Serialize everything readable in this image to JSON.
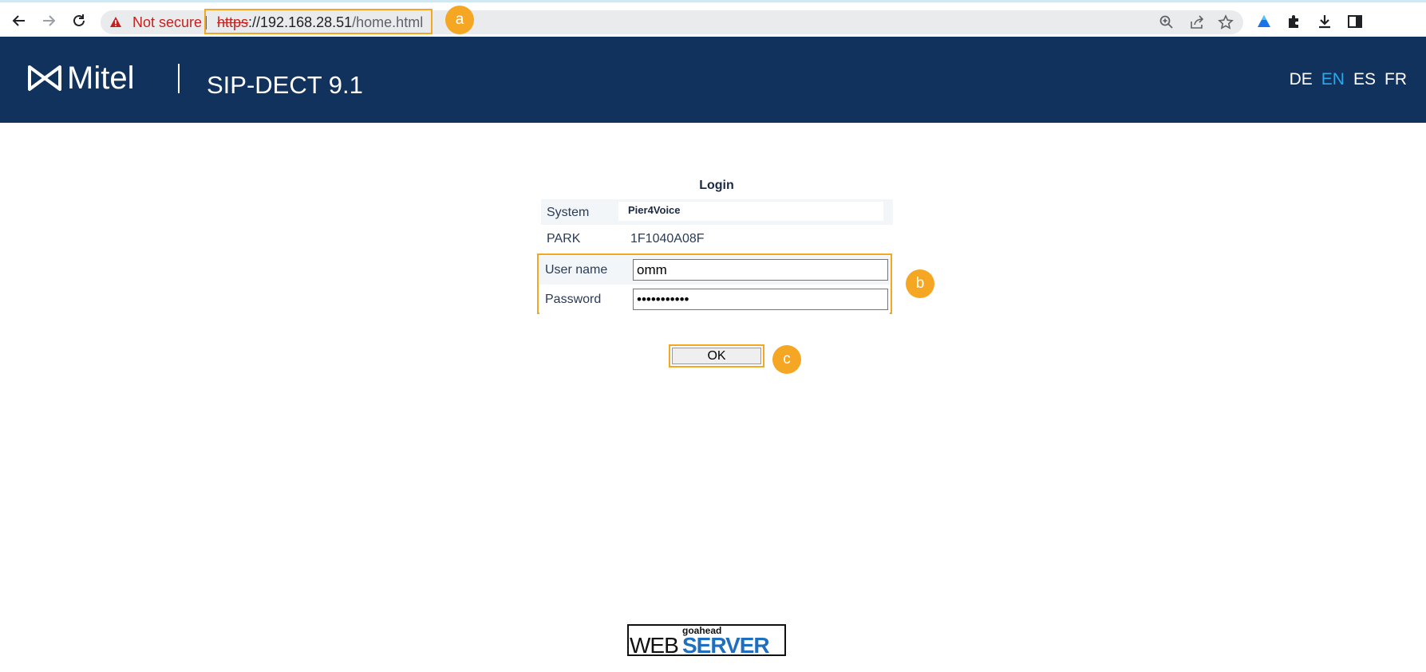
{
  "browser": {
    "security_label": "Not secure",
    "url_scheme": "https",
    "url_host": "://192.168.28.51",
    "url_path": "/home.html",
    "icons": [
      "back-arrow-icon",
      "forward-arrow-icon",
      "reload-icon",
      "warning-icon",
      "zoom-icon",
      "share-icon",
      "star-icon",
      "drive-icon",
      "puzzle-icon",
      "download-icon",
      "side-panel-icon"
    ]
  },
  "annotations": {
    "a": "a",
    "b": "b",
    "c": "c"
  },
  "header": {
    "logo_text": "Mitel",
    "product": "SIP-DECT 9.1",
    "languages": [
      "DE",
      "EN",
      "ES",
      "FR"
    ],
    "active_language": "EN"
  },
  "login": {
    "title": "Login",
    "system_label": "System",
    "system_value": "Pier4Voice",
    "park_label": "PARK",
    "park_value": "1F1040A08F",
    "username_label": "User name",
    "username_value": "omm",
    "password_label": "Password",
    "password_value": "•••••••••••",
    "ok_label": "OK"
  },
  "footer": {
    "small": "goahead",
    "web": "WEB",
    "server": "SERVER"
  },
  "colors": {
    "header_bg": "#12325e",
    "accent": "#f5a623",
    "active_lang": "#2ea7e8",
    "insecure": "#c5221f"
  }
}
